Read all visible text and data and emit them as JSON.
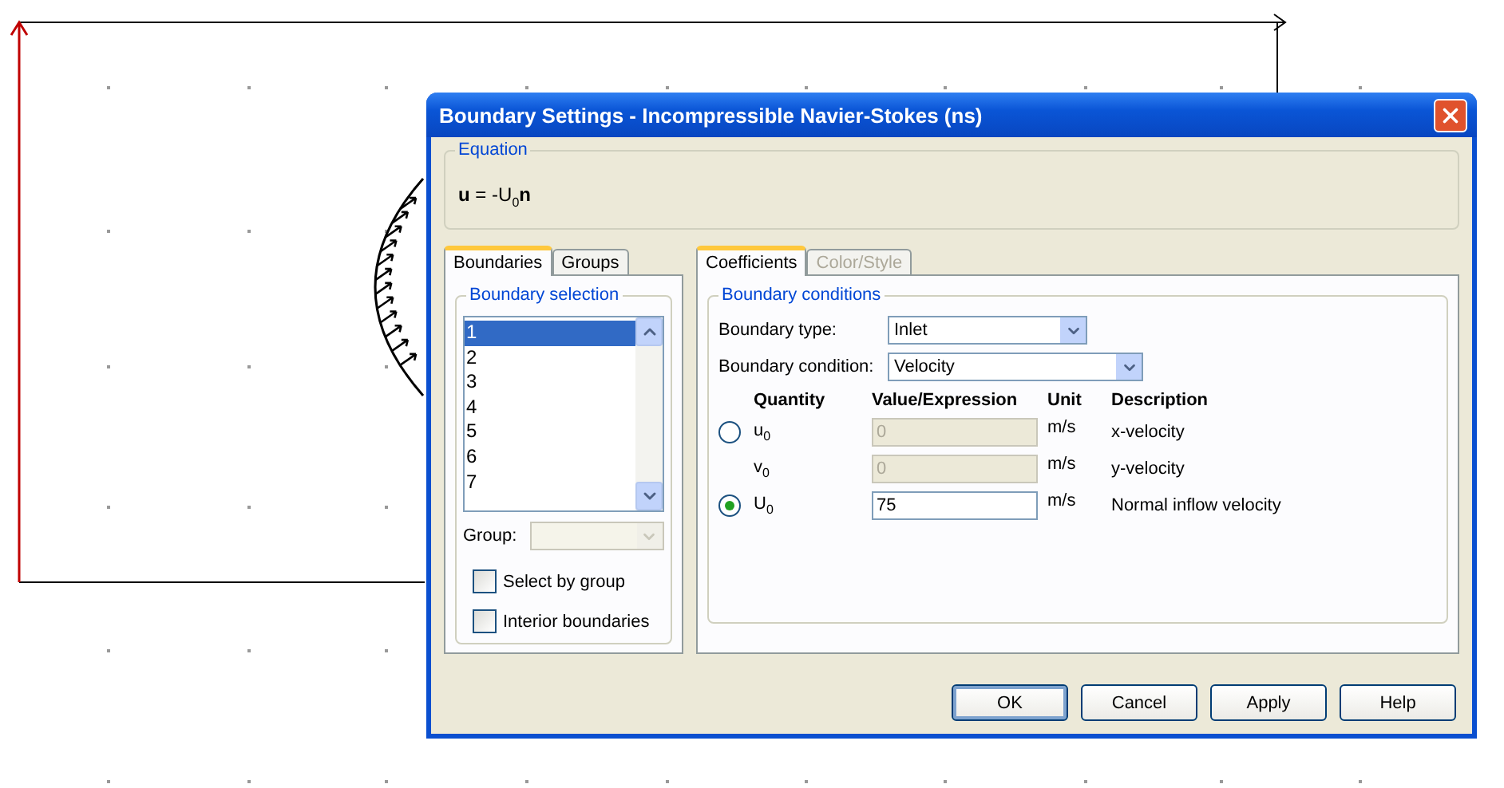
{
  "dialog": {
    "title": "Boundary Settings - Incompressible Navier-Stokes (ns)"
  },
  "equation": {
    "legend": "Equation",
    "formula": "**u** = -U$_{0}$**n**"
  },
  "left_tabs": [
    {
      "label": "Boundaries",
      "selected": true
    },
    {
      "label": "Groups",
      "selected": false
    }
  ],
  "boundary_selection": {
    "legend": "Boundary selection",
    "items": [
      {
        "label": "1",
        "selected": true
      },
      {
        "label": "2",
        "selected": false
      },
      {
        "label": "3",
        "selected": false
      },
      {
        "label": "4",
        "selected": false
      },
      {
        "label": "5",
        "selected": false
      },
      {
        "label": "6",
        "selected": false
      },
      {
        "label": "7",
        "selected": false
      }
    ]
  },
  "group": {
    "label": "Group:",
    "disabled": true
  },
  "checkboxes": [
    {
      "label": "Select by group",
      "checked": false
    },
    {
      "label": "Interior boundaries",
      "checked": false
    }
  ],
  "right_tabs": [
    {
      "label": "Coefficients",
      "selected": true,
      "disabled": false
    },
    {
      "label": "Color/Style",
      "selected": false,
      "disabled": true
    }
  ],
  "boundary_conditions": {
    "legend": "Boundary conditions",
    "fields": [
      {
        "label": "Boundary type:",
        "value": "Inlet",
        "wide": false
      },
      {
        "label": "Boundary condition:",
        "value": "Velocity",
        "wide": true
      }
    ],
    "columns": [
      "Quantity",
      "Value/Expression",
      "Unit",
      "Description"
    ],
    "rows": [
      {
        "kind": "radio",
        "selected": false,
        "quantity": "u$_{0}$",
        "value": "0",
        "disabled": true,
        "unit": "m/s",
        "description": "x-velocity"
      },
      {
        "kind": "plain",
        "quantity": "v$_{0}$",
        "value": "0",
        "disabled": true,
        "unit": "m/s",
        "description": "y-velocity"
      },
      {
        "kind": "radio",
        "selected": true,
        "quantity": "U$_{0}$",
        "value": "75",
        "disabled": false,
        "unit": "m/s",
        "description": "Normal inflow velocity"
      }
    ]
  },
  "buttons": [
    {
      "label": "OK",
      "default": true
    },
    {
      "label": "Cancel",
      "default": false
    },
    {
      "label": "Apply",
      "default": false
    },
    {
      "label": "Help",
      "default": false
    }
  ]
}
